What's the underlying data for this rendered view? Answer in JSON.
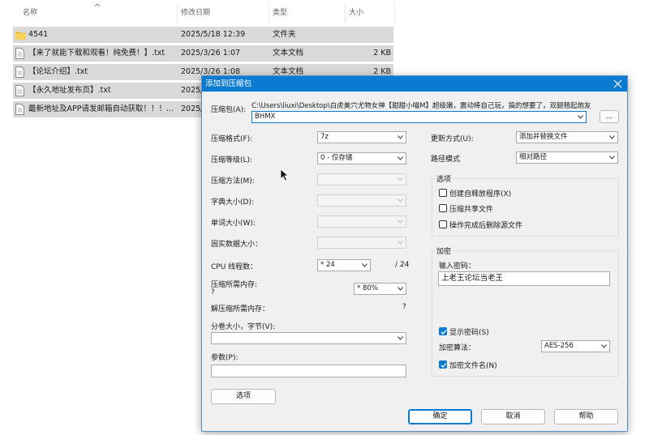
{
  "explorer": {
    "columns": {
      "name": "名称",
      "modified": "修改日期",
      "type": "类型",
      "size": "大小"
    },
    "files": [
      {
        "name": "4541",
        "modified": "2025/5/18 12:39",
        "type": "文件夹",
        "size": "",
        "icon": "folder-icon"
      },
      {
        "name": "【来了就能下载和观看！纯免费！】.txt",
        "modified": "2025/3/26 1:07",
        "type": "文本文档",
        "size": "2 KB",
        "icon": "text-file-icon"
      },
      {
        "name": "【论坛介绍】.txt",
        "modified": "2025/3/26 1:08",
        "type": "文本文档",
        "size": "2 KB",
        "icon": "text-file-icon"
      },
      {
        "name": "【永久地址发布页】.txt",
        "modified": "2025/",
        "type": "",
        "size": "",
        "icon": "text-file-icon"
      },
      {
        "name": "最新地址及APP请发邮箱自动获取！！！...",
        "modified": "2025/",
        "type": "",
        "size": "",
        "icon": "text-file-icon"
      }
    ]
  },
  "dialog": {
    "title": "添加到压缩包",
    "archive_label": "压缩包(A):",
    "archive_path_prefix": "C:\\Users\\liuxi\\Desktop\\白虎美穴尤物女神【甜甜小喵M】超级嫩，震动棒自己玩，搞的想要了，双腿翘起炮友",
    "archive_name": "BHMX",
    "browse_label": "...",
    "format_label": "压缩格式(F):",
    "format_value": "7z",
    "level_label": "压缩等级(L):",
    "level_value": "0 - 仅存储",
    "method_label": "压缩方法(M):",
    "dict_label": "字典大小(D):",
    "word_label": "单词大小(W):",
    "solid_label": "固实数据大小：",
    "cpu_label": "CPU 线程数：",
    "cpu_value": "* 24",
    "cpu_max": "/ 24",
    "mem_comp_label": "压缩所需内存:",
    "mem_comp_q": "?",
    "mem_comp_value": "* 80%",
    "mem_decomp_label": "解压缩所需内存：",
    "mem_decomp_q": "?",
    "volume_label": "分卷大小，字节(V):",
    "params_label": "参数(P):",
    "options_button": "选项",
    "update_label": "更新方式(U):",
    "update_value": "添加并替换文件",
    "path_label": "路径模式",
    "path_value": "相对路径",
    "options_group": "选项",
    "opt_sfx": "创建自释放程序(X)",
    "opt_shared": "压缩共享文件",
    "opt_delete": "操作完成后删除源文件",
    "encrypt_group": "加密",
    "password_label": "输入密码：",
    "password_value": "上老王论坛当老王",
    "show_password": "显示密码(S)",
    "enc_method_label": "加密算法：",
    "enc_method_value": "AES-256",
    "encrypt_names": "加密文件名(N)",
    "ok": "确定",
    "cancel": "取消",
    "help": "帮助"
  }
}
